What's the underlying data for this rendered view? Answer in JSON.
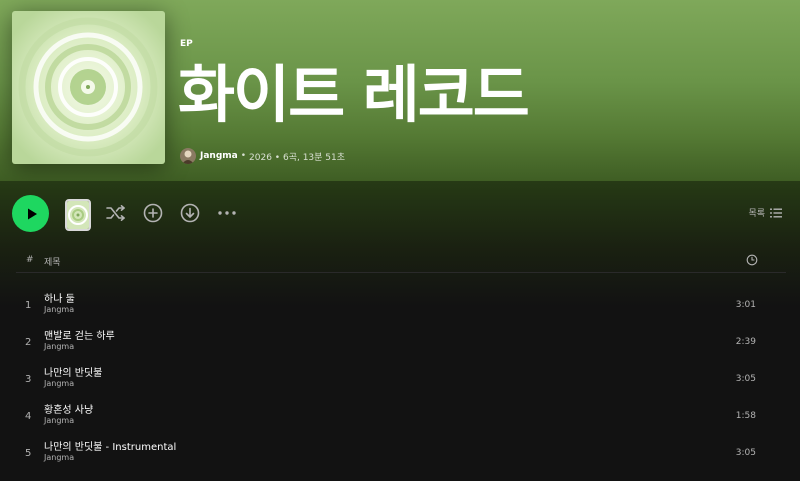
{
  "album": {
    "type_label": "EP",
    "title": "화이트 레코드",
    "artist": "Jangma",
    "separator": "•",
    "year_and_stats": "2026 • 6곡, 13분 51초"
  },
  "actions": {
    "list_view_label": "목록"
  },
  "tracklist": {
    "header_number": "#",
    "header_title": "제목",
    "tracks": [
      {
        "number": "1",
        "title": "하나 둘",
        "artist": "Jangma",
        "duration": "3:01"
      },
      {
        "number": "2",
        "title": "맨발로 걷는 하루",
        "artist": "Jangma",
        "duration": "2:39"
      },
      {
        "number": "3",
        "title": "나만의 반딧불",
        "artist": "Jangma",
        "duration": "3:05"
      },
      {
        "number": "4",
        "title": "황혼성 사냥",
        "artist": "Jangma",
        "duration": "1:58"
      },
      {
        "number": "5",
        "title": "나만의 반딧불 - Instrumental",
        "artist": "Jangma",
        "duration": "3:05"
      }
    ]
  },
  "colors": {
    "accent_green": "#1ed760",
    "hero_green": "#6a9448",
    "background": "#121212",
    "muted_text": "#b3b3b3"
  },
  "icons": [
    "play-icon",
    "shuffle-icon",
    "add-icon",
    "download-icon",
    "more-options-icon",
    "list-view-icon",
    "clock-icon"
  ]
}
